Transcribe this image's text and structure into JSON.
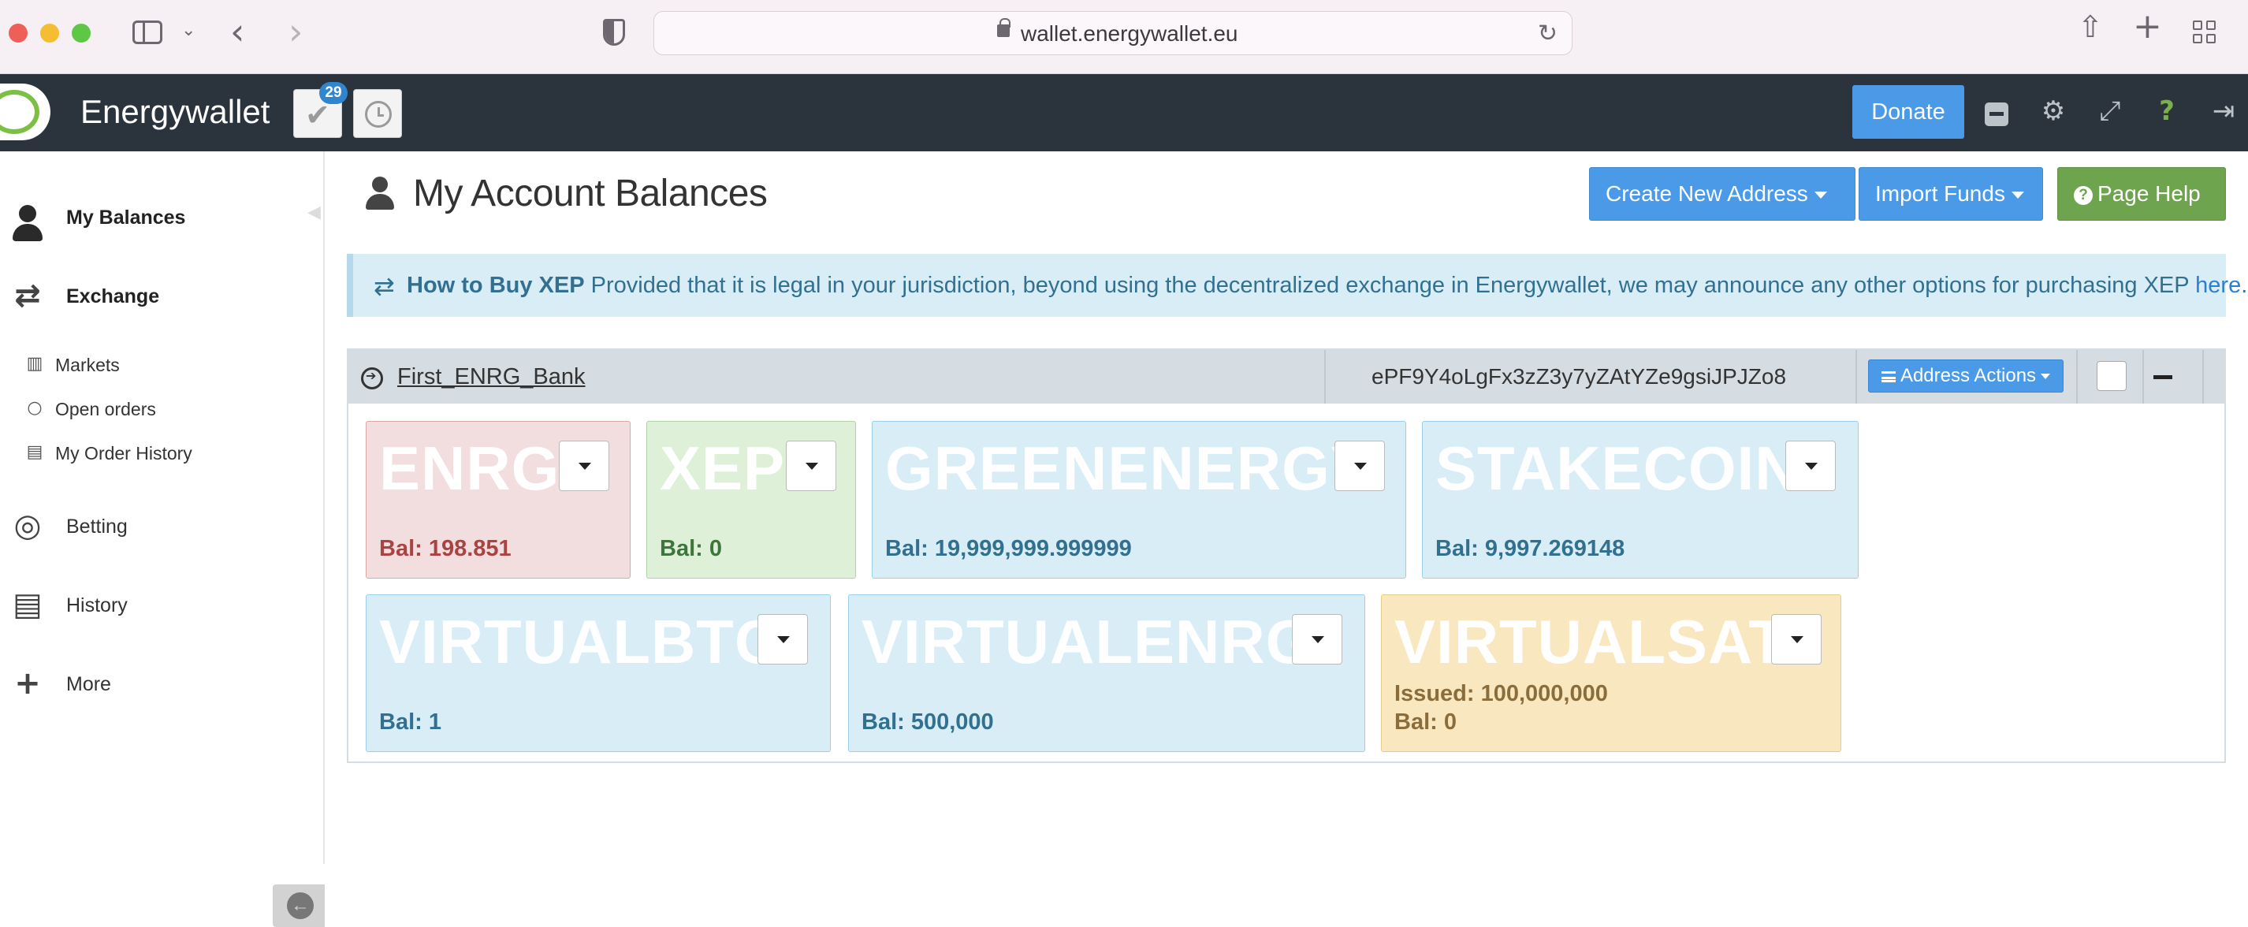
{
  "browser": {
    "url": "wallet.energywallet.eu"
  },
  "header": {
    "brand": "Energywallet",
    "notification_count": "29",
    "donate_label": "Donate"
  },
  "sidebar": {
    "items": [
      {
        "label": "My Balances",
        "icon": "user-icon"
      },
      {
        "label": "Exchange",
        "icon": "exchange-icon"
      },
      {
        "label": "Betting",
        "icon": "bullseye-icon"
      },
      {
        "label": "History",
        "icon": "book-icon"
      },
      {
        "label": "More",
        "icon": "plus-icon"
      }
    ],
    "exchange_sub": [
      {
        "label": "Markets",
        "icon": "bar-chart-icon"
      },
      {
        "label": "Open orders",
        "icon": "circle-icon"
      },
      {
        "label": "My Order History",
        "icon": "book-icon"
      }
    ]
  },
  "main": {
    "title": "My Account Balances",
    "create_label": "Create New Address",
    "import_label": "Import Funds",
    "help_label": "Page Help",
    "alert": {
      "heading": "How to Buy XEP",
      "text": " Provided that it is legal in your jurisdiction, beyond using the decentralized exchange in Energywallet, we may announce any other options for purchasing XEP ",
      "link": "here",
      "end": "."
    },
    "address": {
      "name": "First_ENRG_Bank",
      "hash": "ePF9Y4oLgFx3zZ3y7yZAtYZe9gsiJPJZo8",
      "actions_label": "Address Actions"
    },
    "assets": [
      {
        "ticker": "ENRG",
        "balance": "Bal: 198.851",
        "color": "#f2dede"
      },
      {
        "ticker": "XEP",
        "balance": "Bal: 0",
        "color": "#dff0d8"
      },
      {
        "ticker": "GREENENERGY",
        "balance": "Bal: 19,999,999.999999",
        "color": "#d9edf7"
      },
      {
        "ticker": "STAKECOIN",
        "balance": "Bal: 9,997.269148",
        "color": "#d9edf7"
      },
      {
        "ticker": "VIRTUALBTC",
        "balance": "Bal: 1",
        "color": "#d9edf7"
      },
      {
        "ticker": "VIRTUALENRG",
        "balance": "Bal: 500,000",
        "color": "#d9edf7"
      },
      {
        "ticker": "VIRTUALSAT",
        "issued": "Issued: 100,000,000",
        "balance": "Bal: 0",
        "color": "#f9e7bf"
      }
    ]
  }
}
